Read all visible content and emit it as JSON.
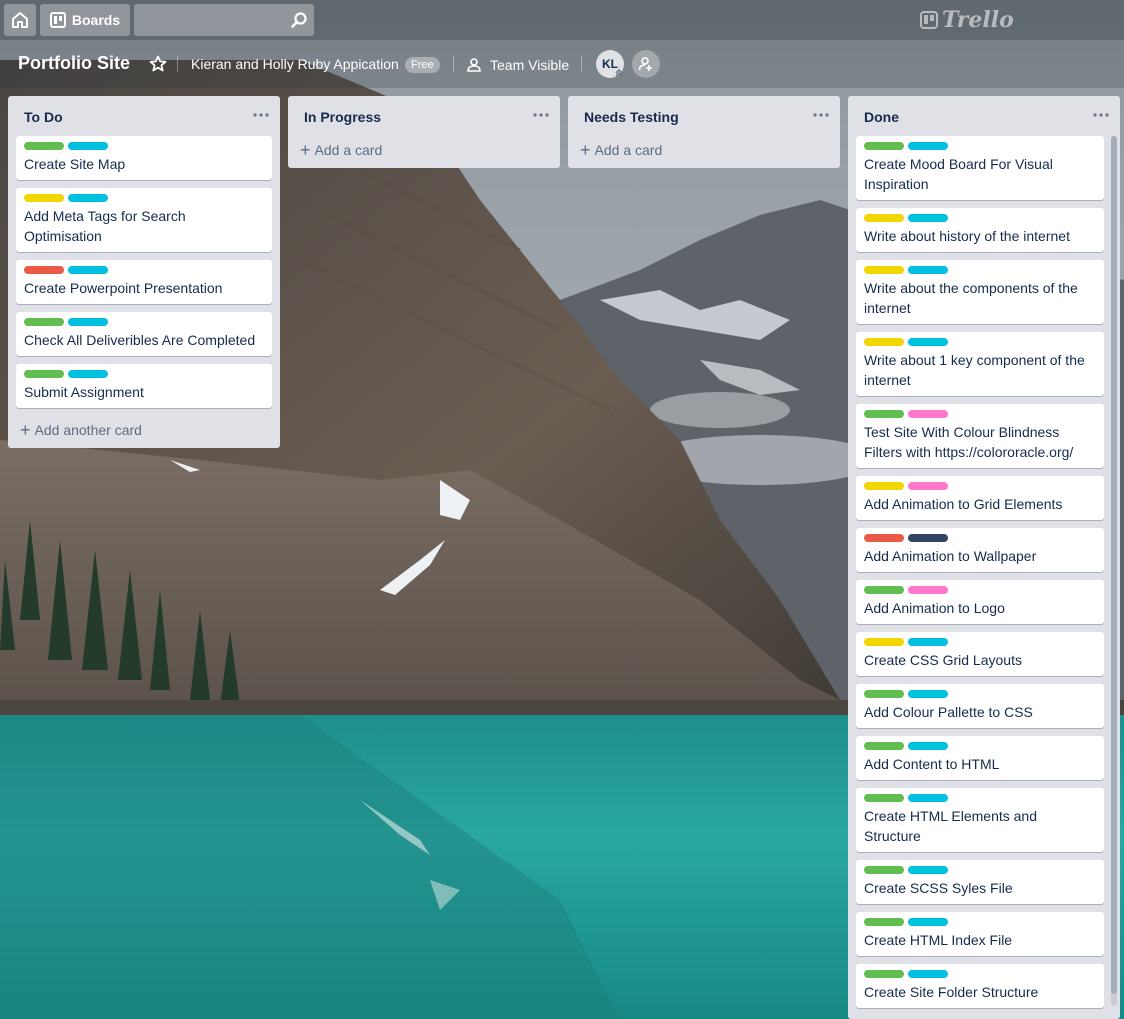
{
  "colors": {
    "green": "#61bd4f",
    "yellow": "#f2d600",
    "red": "#eb5a46",
    "sky": "#00c2e0",
    "pink": "#ff78cb",
    "black": "#344563"
  },
  "header": {
    "boards_label": "Boards",
    "search_placeholder": "",
    "logo_text": "Trello",
    "home_icon": "home-icon",
    "search_icon": "search-icon"
  },
  "board": {
    "title": "Portfolio Site",
    "team": "Kieran and Holly Ruby Appication",
    "plan_badge": "Free",
    "visibility": "Team Visible",
    "member_initials": "KL"
  },
  "lists": [
    {
      "title": "To Do",
      "add_label": "Add another card",
      "cards": [
        {
          "labels": [
            "green",
            "sky"
          ],
          "title": "Create Site Map"
        },
        {
          "labels": [
            "yellow",
            "sky"
          ],
          "title": "Add Meta Tags for Search Optimisation"
        },
        {
          "labels": [
            "red",
            "sky"
          ],
          "title": "Create Powerpoint Presentation"
        },
        {
          "labels": [
            "green",
            "sky"
          ],
          "title": "Check All Deliveribles Are Completed"
        },
        {
          "labels": [
            "green",
            "sky"
          ],
          "title": "Submit Assignment"
        }
      ]
    },
    {
      "title": "In Progress",
      "add_label": "Add a card",
      "cards": []
    },
    {
      "title": "Needs Testing",
      "add_label": "Add a card",
      "cards": []
    },
    {
      "title": "Done",
      "add_label": "",
      "cards": [
        {
          "labels": [
            "green",
            "sky"
          ],
          "title": "Create Mood Board For Visual Inspiration"
        },
        {
          "labels": [
            "yellow",
            "sky"
          ],
          "title": "Write about history of the internet"
        },
        {
          "labels": [
            "yellow",
            "sky"
          ],
          "title": "Write about the components of the internet"
        },
        {
          "labels": [
            "yellow",
            "sky"
          ],
          "title": "Write about 1 key component of the internet"
        },
        {
          "labels": [
            "green",
            "pink"
          ],
          "title": "Test Site With Colour Blindness Filters with https://colororacle.org/"
        },
        {
          "labels": [
            "yellow",
            "pink"
          ],
          "title": "Add Animation to Grid Elements"
        },
        {
          "labels": [
            "red",
            "black"
          ],
          "title": "Add Animation to Wallpaper"
        },
        {
          "labels": [
            "green",
            "pink"
          ],
          "title": "Add Animation to Logo"
        },
        {
          "labels": [
            "yellow",
            "sky"
          ],
          "title": "Create CSS Grid Layouts"
        },
        {
          "labels": [
            "green",
            "sky"
          ],
          "title": "Add Colour Pallette to CSS"
        },
        {
          "labels": [
            "green",
            "sky"
          ],
          "title": "Add Content to HTML"
        },
        {
          "labels": [
            "green",
            "sky"
          ],
          "title": "Create HTML Elements and Structure"
        },
        {
          "labels": [
            "green",
            "sky"
          ],
          "title": "Create SCSS Syles File"
        },
        {
          "labels": [
            "green",
            "sky"
          ],
          "title": "Create HTML Index File"
        },
        {
          "labels": [
            "green",
            "sky"
          ],
          "title": "Create Site Folder Structure"
        }
      ]
    }
  ]
}
